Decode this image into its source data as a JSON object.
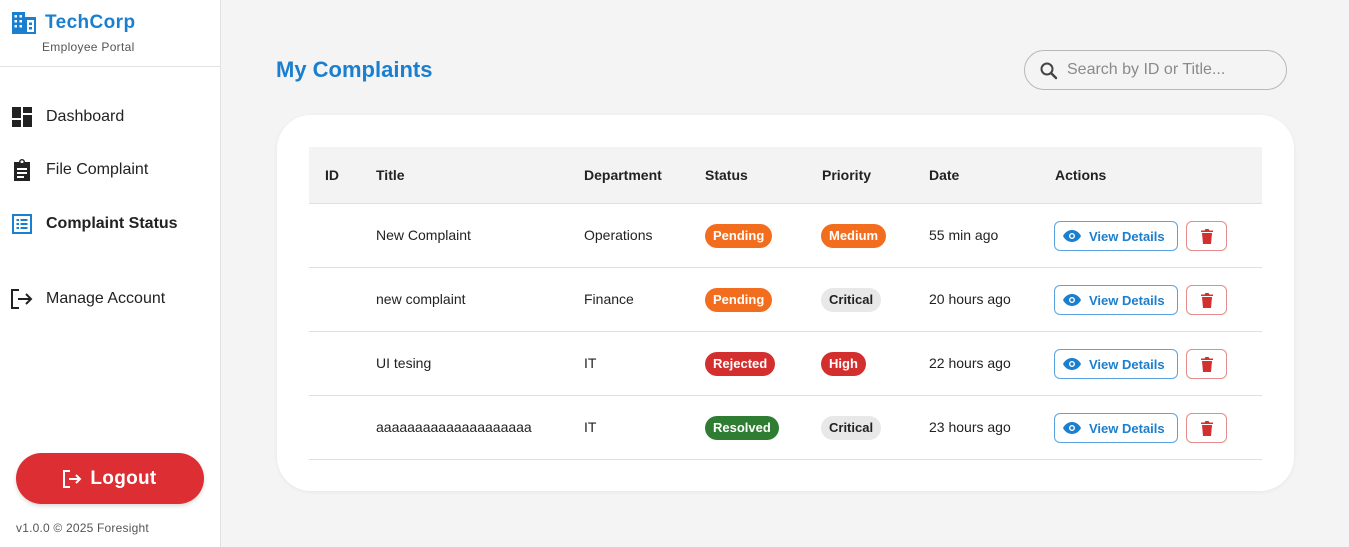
{
  "brand": {
    "name": "TechCorp",
    "subtitle": "Employee Portal"
  },
  "nav": [
    {
      "label": "Dashboard",
      "icon": "dashboard-icon"
    },
    {
      "label": "File Complaint",
      "icon": "clipboard-icon"
    },
    {
      "label": "Complaint Status",
      "icon": "list-icon",
      "active": true
    },
    {
      "label": "Manage Account",
      "icon": "exit-icon"
    }
  ],
  "logout_label": "Logout",
  "version": "v1.0.0 © 2025 Foresight",
  "page_title": "My Complaints",
  "search": {
    "placeholder": "Search by ID or Title...",
    "value": ""
  },
  "table": {
    "headers": [
      "ID",
      "Title",
      "Department",
      "Status",
      "Priority",
      "Date",
      "Actions"
    ],
    "rows": [
      {
        "id": "",
        "title": "New Complaint",
        "department": "Operations",
        "status": "Pending",
        "priority": "Medium",
        "date": "55 min ago"
      },
      {
        "id": "",
        "title": "new complaint",
        "department": "Finance",
        "status": "Pending",
        "priority": "Critical",
        "date": "20 hours ago"
      },
      {
        "id": "",
        "title": "UI tesing",
        "department": "IT",
        "status": "Rejected",
        "priority": "High",
        "date": "22 hours ago"
      },
      {
        "id": "",
        "title": "aaaaaaaaaaaaaaaaaaaa",
        "department": "IT",
        "status": "Resolved",
        "priority": "Critical",
        "date": "23 hours ago"
      }
    ],
    "view_label": "View Details"
  },
  "colors": {
    "accent": "#1a7fcf",
    "danger": "#dc2e33",
    "pending": "#f26d1e",
    "rejected": "#d32f2f",
    "resolved": "#2e7d32",
    "critical_bg": "#e8e8e8"
  }
}
